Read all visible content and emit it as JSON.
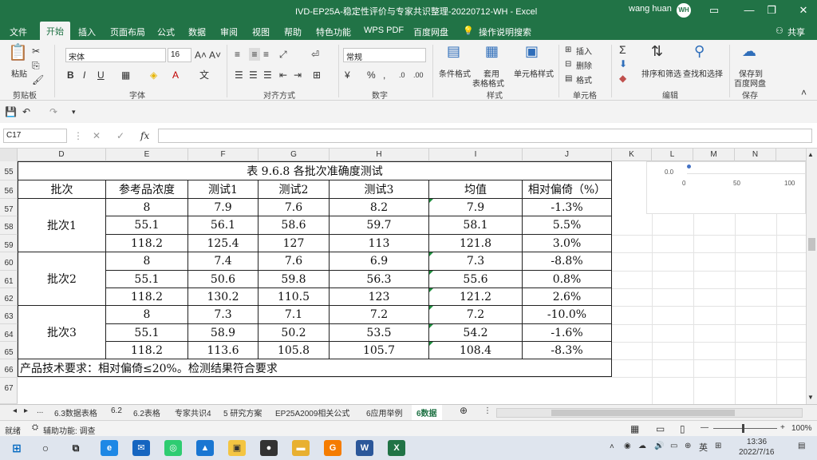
{
  "window": {
    "title": "IVD-EP25A-稳定性评价与专家共识整理-20220712-WH  -  Excel",
    "user": "wang huan",
    "avatar": "WH"
  },
  "menu": [
    "文件",
    "开始",
    "插入",
    "页面布局",
    "公式",
    "数据",
    "审阅",
    "视图",
    "帮助",
    "特色功能",
    "WPS PDF",
    "百度网盘",
    "操作说明搜索"
  ],
  "share": "共享",
  "ribbon": {
    "paste": "粘贴",
    "font_name": "宋体",
    "font_size": "16",
    "number_format": "常规",
    "conditional": "条件格式",
    "table_style_1": "套用",
    "table_style_2": "表格格式",
    "cell_style": "单元格样式",
    "insert": "插入",
    "delete": "删除",
    "format": "格式",
    "sort": "排序和筛选",
    "find": "查找和选择",
    "save_1": "保存到",
    "save_2": "百度网盘",
    "groups": [
      "剪贴板",
      "字体",
      "对齐方式",
      "数字",
      "样式",
      "单元格",
      "编辑",
      "保存"
    ]
  },
  "formula": {
    "name_box": "C17",
    "fx": "fx",
    "value": ""
  },
  "columns": [
    "D",
    "E",
    "F",
    "G",
    "H",
    "I",
    "J",
    "K",
    "L",
    "M",
    "N"
  ],
  "rows": [
    "55",
    "56",
    "57",
    "58",
    "59",
    "60",
    "61",
    "62",
    "63",
    "64",
    "65",
    "66",
    "67"
  ],
  "table": {
    "title": "表 9.6.8 各批次准确度测试",
    "headers": [
      "批次",
      "参考品浓度",
      "测试1",
      "测试2",
      "测试3",
      "均值",
      "相对偏倚（%）"
    ],
    "groups": [
      {
        "batch": "批次1",
        "rows": [
          [
            "8",
            "7.9",
            "7.6",
            "8.2",
            "7.9",
            "-1.3%"
          ],
          [
            "55.1",
            "56.1",
            "58.6",
            "59.7",
            "58.1",
            "5.5%"
          ],
          [
            "118.2",
            "125.4",
            "127",
            "113",
            "121.8",
            "3.0%"
          ]
        ]
      },
      {
        "batch": "批次2",
        "rows": [
          [
            "8",
            "7.4",
            "7.6",
            "6.9",
            "7.3",
            "-8.8%"
          ],
          [
            "55.1",
            "50.6",
            "59.8",
            "56.3",
            "55.6",
            "0.8%"
          ],
          [
            "118.2",
            "130.2",
            "110.5",
            "123",
            "121.2",
            "2.6%"
          ]
        ]
      },
      {
        "batch": "批次3",
        "rows": [
          [
            "8",
            "7.3",
            "7.1",
            "7.2",
            "7.2",
            "-10.0%"
          ],
          [
            "55.1",
            "58.9",
            "50.2",
            "53.5",
            "54.2",
            "-1.6%"
          ],
          [
            "118.2",
            "113.6",
            "105.8",
            "105.7",
            "108.4",
            "-8.3%"
          ]
        ]
      }
    ],
    "note": "产品技术要求：相对偏倚≤20%。检测结果符合要求"
  },
  "mini_chart": {
    "y_label": "0.0",
    "x_ticks": [
      "0",
      "50",
      "100"
    ]
  },
  "sheet_tabs": [
    "...",
    "6.3数据表格",
    "6.2",
    "6.2表格",
    "专家共识4",
    "5 研究方案",
    "EP25A2009相关公式",
    "6应用举例",
    "6数据"
  ],
  "status": {
    "ready": "就绪",
    "accessibility": "辅助功能: 调查",
    "zoom": "100%"
  },
  "taskbar": {
    "time": "13:36",
    "date": "2022/7/16",
    "lang": "英"
  }
}
